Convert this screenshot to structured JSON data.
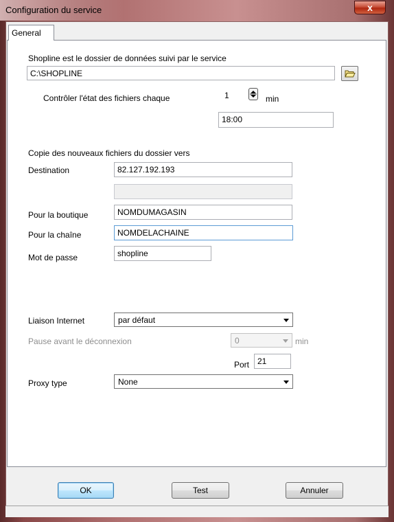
{
  "window": {
    "title": "Configuration du service",
    "close_label": "x"
  },
  "tabs": [
    {
      "label": "General"
    }
  ],
  "general": {
    "folder_label": "Shopline est le dossier de données suivi par le service",
    "folder_value": "C:\\SHOPLINE",
    "check_label": "Contrôler l'état des fichiers chaque",
    "check_value": "1",
    "check_unit": "min",
    "time_value": "18:00",
    "copy_label": "Copie des nouveaux fichiers du dossier vers",
    "destination_label": "Destination",
    "destination_value": "82.127.192.193",
    "destination_extra_value": "",
    "shop_label": "Pour la boutique",
    "shop_value": "NOMDUMAGASIN",
    "chain_label": "Pour la chaîne",
    "chain_value": "NOMDELACHAINE",
    "password_label": "Mot de passe",
    "password_value": "shopline",
    "internet_label": "Liaison Internet",
    "internet_value": "par défaut",
    "pause_label": "Pause avant le déconnexion",
    "pause_value": "0",
    "pause_unit": "min",
    "port_label": "Port",
    "port_value": "21",
    "proxy_label": "Proxy type",
    "proxy_value": "None"
  },
  "buttons": {
    "ok": "OK",
    "test": "Test",
    "cancel": "Annuler"
  }
}
